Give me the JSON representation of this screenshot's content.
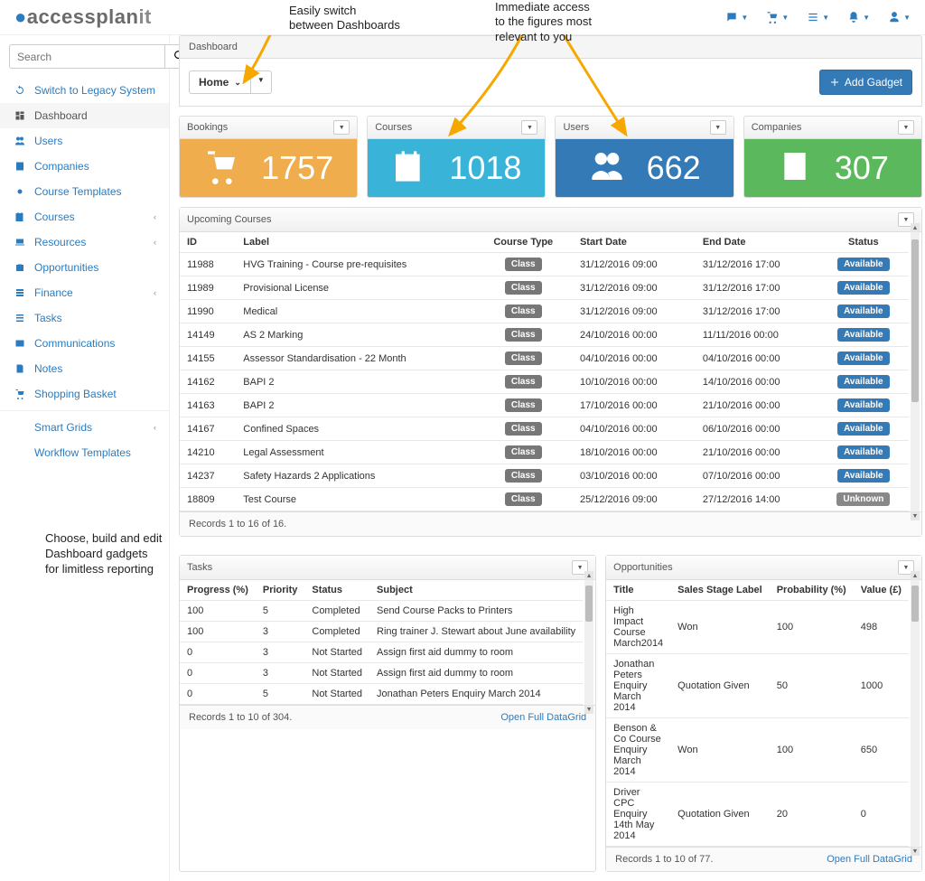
{
  "brand_prefix": "accessplan",
  "brand_suffix": "it",
  "search_placeholder": "Search",
  "breadcrumb": "Dashboard",
  "home_select": "Home",
  "add_gadget": "Add Gadget",
  "annotations": {
    "switch": "Easily switch\nbetween Dashboards",
    "figures": "Immediate access\nto the figures most\nrelevant to you",
    "gadgets": "Choose, build and edit\nDashboard gadgets\nfor limitless reporting"
  },
  "nav": [
    {
      "label": "Switch to Legacy System",
      "icon": "refresh",
      "chev": false
    },
    {
      "label": "Dashboard",
      "icon": "dashboard",
      "chev": false,
      "active": true
    },
    {
      "label": "Users",
      "icon": "users",
      "chev": false
    },
    {
      "label": "Companies",
      "icon": "company",
      "chev": false
    },
    {
      "label": "Course Templates",
      "icon": "dot",
      "chev": false
    },
    {
      "label": "Courses",
      "icon": "calendar",
      "chev": true
    },
    {
      "label": "Resources",
      "icon": "laptop",
      "chev": true
    },
    {
      "label": "Opportunities",
      "icon": "briefcase",
      "chev": false
    },
    {
      "label": "Finance",
      "icon": "finance",
      "chev": true
    },
    {
      "label": "Tasks",
      "icon": "tasks",
      "chev": false
    },
    {
      "label": "Communications",
      "icon": "mail",
      "chev": false
    },
    {
      "label": "Notes",
      "icon": "note",
      "chev": false
    },
    {
      "label": "Shopping Basket",
      "icon": "cart",
      "chev": false
    },
    {
      "label": "Smart Grids",
      "icon": "",
      "chev": true,
      "divider_before": true
    },
    {
      "label": "Workflow Templates",
      "icon": "",
      "chev": false
    }
  ],
  "tiles": [
    {
      "title": "Bookings",
      "value": "1757",
      "color": "t-orange",
      "icon": "cart"
    },
    {
      "title": "Courses",
      "value": "1018",
      "color": "t-blue",
      "icon": "calcheck"
    },
    {
      "title": "Users",
      "value": "662",
      "color": "t-dblue",
      "icon": "users"
    },
    {
      "title": "Companies",
      "value": "307",
      "color": "t-green",
      "icon": "building"
    }
  ],
  "upcoming": {
    "title": "Upcoming Courses",
    "headers": [
      "ID",
      "Label",
      "Course Type",
      "Start Date",
      "End Date",
      "Status"
    ],
    "footer": "Records 1 to 16 of 16.",
    "rows": [
      {
        "id": "11988",
        "label": "HVG Training - Course pre-requisites",
        "type": "Class",
        "start": "31/12/2016 09:00",
        "end": "31/12/2016 17:00",
        "status": "Available"
      },
      {
        "id": "11989",
        "label": "Provisional License",
        "type": "Class",
        "start": "31/12/2016 09:00",
        "end": "31/12/2016 17:00",
        "status": "Available"
      },
      {
        "id": "11990",
        "label": "Medical",
        "type": "Class",
        "start": "31/12/2016 09:00",
        "end": "31/12/2016 17:00",
        "status": "Available"
      },
      {
        "id": "14149",
        "label": "AS 2 Marking",
        "type": "Class",
        "start": "24/10/2016 00:00",
        "end": "11/11/2016 00:00",
        "status": "Available"
      },
      {
        "id": "14155",
        "label": "Assessor Standardisation - 22 Month",
        "type": "Class",
        "start": "04/10/2016 00:00",
        "end": "04/10/2016 00:00",
        "status": "Available"
      },
      {
        "id": "14162",
        "label": "BAPI 2",
        "type": "Class",
        "start": "10/10/2016 00:00",
        "end": "14/10/2016 00:00",
        "status": "Available"
      },
      {
        "id": "14163",
        "label": "BAPI 2",
        "type": "Class",
        "start": "17/10/2016 00:00",
        "end": "21/10/2016 00:00",
        "status": "Available"
      },
      {
        "id": "14167",
        "label": "Confined Spaces",
        "type": "Class",
        "start": "04/10/2016 00:00",
        "end": "06/10/2016 00:00",
        "status": "Available"
      },
      {
        "id": "14210",
        "label": "Legal Assessment",
        "type": "Class",
        "start": "18/10/2016 00:00",
        "end": "21/10/2016 00:00",
        "status": "Available"
      },
      {
        "id": "14237",
        "label": "Safety Hazards 2 Applications",
        "type": "Class",
        "start": "03/10/2016 00:00",
        "end": "07/10/2016 00:00",
        "status": "Available"
      },
      {
        "id": "18809",
        "label": "Test Course",
        "type": "Class",
        "start": "25/12/2016 09:00",
        "end": "27/12/2016 14:00",
        "status": "Unknown"
      }
    ]
  },
  "tasks": {
    "title": "Tasks",
    "headers": [
      "Progress (%)",
      "Priority",
      "Status",
      "Subject"
    ],
    "footer": "Records 1 to 10 of 304.",
    "open_link": "Open Full DataGrid",
    "rows": [
      {
        "progress": "100",
        "priority": "5",
        "status": "Completed",
        "subject": "Send Course Packs to Printers"
      },
      {
        "progress": "100",
        "priority": "3",
        "status": "Completed",
        "subject": "Ring trainer J. Stewart about June availability"
      },
      {
        "progress": "0",
        "priority": "3",
        "status": "Not Started",
        "subject": "Assign first aid dummy to room"
      },
      {
        "progress": "0",
        "priority": "3",
        "status": "Not Started",
        "subject": "Assign first aid dummy to room"
      },
      {
        "progress": "0",
        "priority": "5",
        "status": "Not Started",
        "subject": "Jonathan Peters Enquiry March 2014"
      }
    ]
  },
  "opps": {
    "title": "Opportunities",
    "headers": [
      "Title",
      "Sales Stage Label",
      "Probability (%)",
      "Value (£)"
    ],
    "footer": "Records 1 to 10 of 77.",
    "open_link": "Open Full DataGrid",
    "rows": [
      {
        "title": "High Impact Course March2014",
        "stage": "Won",
        "prob": "100",
        "value": "498"
      },
      {
        "title": "Jonathan Peters Enquiry March 2014",
        "stage": "Quotation Given",
        "prob": "50",
        "value": "1000"
      },
      {
        "title": "Benson & Co Course Enquiry March 2014",
        "stage": "Won",
        "prob": "100",
        "value": "650"
      },
      {
        "title": "Driver CPC Enquiry 14th May 2014",
        "stage": "Quotation Given",
        "prob": "20",
        "value": "0"
      }
    ]
  }
}
